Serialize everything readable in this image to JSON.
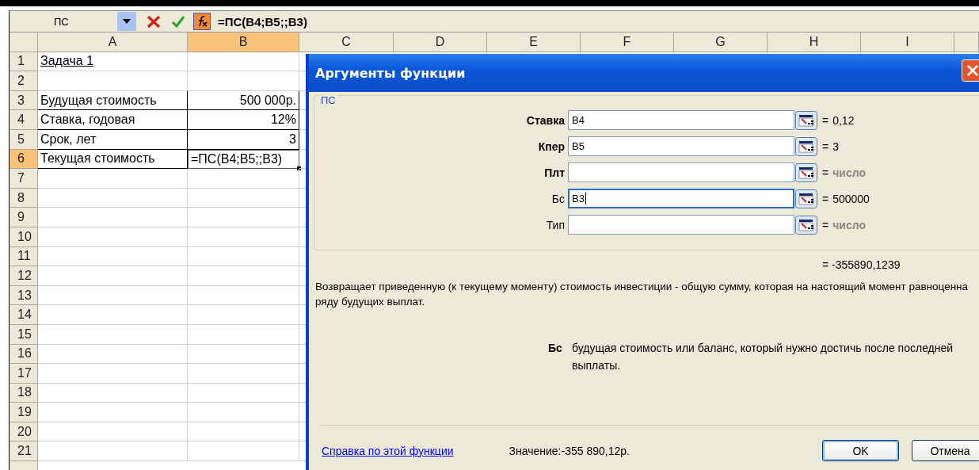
{
  "formula_bar": {
    "name_box": "ПС",
    "formula": "=ПС(B4;B5;;B3)"
  },
  "columns": [
    {
      "label": "A",
      "selected": false
    },
    {
      "label": "B",
      "selected": true
    },
    {
      "label": "C",
      "selected": false
    },
    {
      "label": "D",
      "selected": false
    },
    {
      "label": "E",
      "selected": false
    },
    {
      "label": "F",
      "selected": false
    },
    {
      "label": "G",
      "selected": false
    },
    {
      "label": "H",
      "selected": false
    },
    {
      "label": "I",
      "selected": false
    }
  ],
  "rows": [
    {
      "number": "1",
      "selected": false,
      "bordered": false,
      "cells": [
        {
          "text": "Задача 1",
          "underlined": true,
          "active": false
        }
      ]
    },
    {
      "number": "2",
      "selected": false,
      "bordered": false,
      "cells": []
    },
    {
      "number": "3",
      "selected": false,
      "bordered": true,
      "cells": [
        {
          "text": "Будущая стоимость",
          "underlined": false,
          "active": false
        },
        {
          "text": "500 000р.",
          "underlined": false,
          "active": false
        }
      ]
    },
    {
      "number": "4",
      "selected": false,
      "bordered": true,
      "cells": [
        {
          "text": "Ставка, годовая",
          "underlined": false,
          "active": false
        },
        {
          "text": "12%",
          "underlined": false,
          "active": false
        }
      ]
    },
    {
      "number": "5",
      "selected": false,
      "bordered": true,
      "cells": [
        {
          "text": "Срок, лет",
          "underlined": false,
          "active": false
        },
        {
          "text": "3",
          "underlined": false,
          "active": false
        }
      ]
    },
    {
      "number": "6",
      "selected": true,
      "bordered": true,
      "cells": [
        {
          "text": "Текущая стоимость",
          "underlined": false,
          "active": false
        },
        {
          "text": "=ПС(B4;B5;;B3)",
          "underlined": false,
          "active": true
        }
      ]
    },
    {
      "number": "7",
      "selected": false,
      "bordered": false,
      "cells": []
    },
    {
      "number": "8",
      "selected": false,
      "bordered": false,
      "cells": []
    },
    {
      "number": "9",
      "selected": false,
      "bordered": false,
      "cells": []
    },
    {
      "number": "10",
      "selected": false,
      "bordered": false,
      "cells": []
    },
    {
      "number": "11",
      "selected": false,
      "bordered": false,
      "cells": []
    },
    {
      "number": "12",
      "selected": false,
      "bordered": false,
      "cells": []
    },
    {
      "number": "13",
      "selected": false,
      "bordered": false,
      "cells": []
    },
    {
      "number": "14",
      "selected": false,
      "bordered": false,
      "cells": []
    },
    {
      "number": "15",
      "selected": false,
      "bordered": false,
      "cells": []
    },
    {
      "number": "16",
      "selected": false,
      "bordered": false,
      "cells": []
    },
    {
      "number": "17",
      "selected": false,
      "bordered": false,
      "cells": []
    },
    {
      "number": "18",
      "selected": false,
      "bordered": false,
      "cells": []
    },
    {
      "number": "19",
      "selected": false,
      "bordered": false,
      "cells": []
    },
    {
      "number": "20",
      "selected": false,
      "bordered": false,
      "cells": []
    },
    {
      "number": "21",
      "selected": false,
      "bordered": false,
      "cells": []
    }
  ],
  "dialog": {
    "title": "Аргументы функции",
    "group_label": "ПС",
    "arguments": [
      {
        "label": "Ставка",
        "required": true,
        "value": "B4",
        "focused": false,
        "sign": "=",
        "result": "0,12",
        "hint": false
      },
      {
        "label": "Кпер",
        "required": true,
        "value": "B5",
        "focused": false,
        "sign": "=",
        "result": "3",
        "hint": false
      },
      {
        "label": "Плт",
        "required": true,
        "focused": false,
        "sign": "=",
        "result": "число",
        "hint": true
      },
      {
        "label": "Бс",
        "required": false,
        "value": "B3",
        "focused": true,
        "sign": "=",
        "result": "500000",
        "hint": false
      },
      {
        "label": "Тип",
        "required": false,
        "focused": false,
        "sign": "=",
        "result": "число",
        "hint": true
      }
    ],
    "formula_result": "= -355890,1239",
    "description": "Возвращает приведенную (к текущему моменту) стоимость инвестиции - общую сумму, которая на настоящий момент равноценна ряду будущих выплат.",
    "argument_help": {
      "name": "Бс",
      "text": "будущая стоимость или баланс, который нужно достичь после последней выплаты."
    },
    "help_link": "Справка по этой функции",
    "value_label": "Значение:",
    "value": "-355 890,12р.",
    "buttons": [
      {
        "label": "OK",
        "default": true
      },
      {
        "label": "Отмена",
        "default": false
      }
    ]
  }
}
